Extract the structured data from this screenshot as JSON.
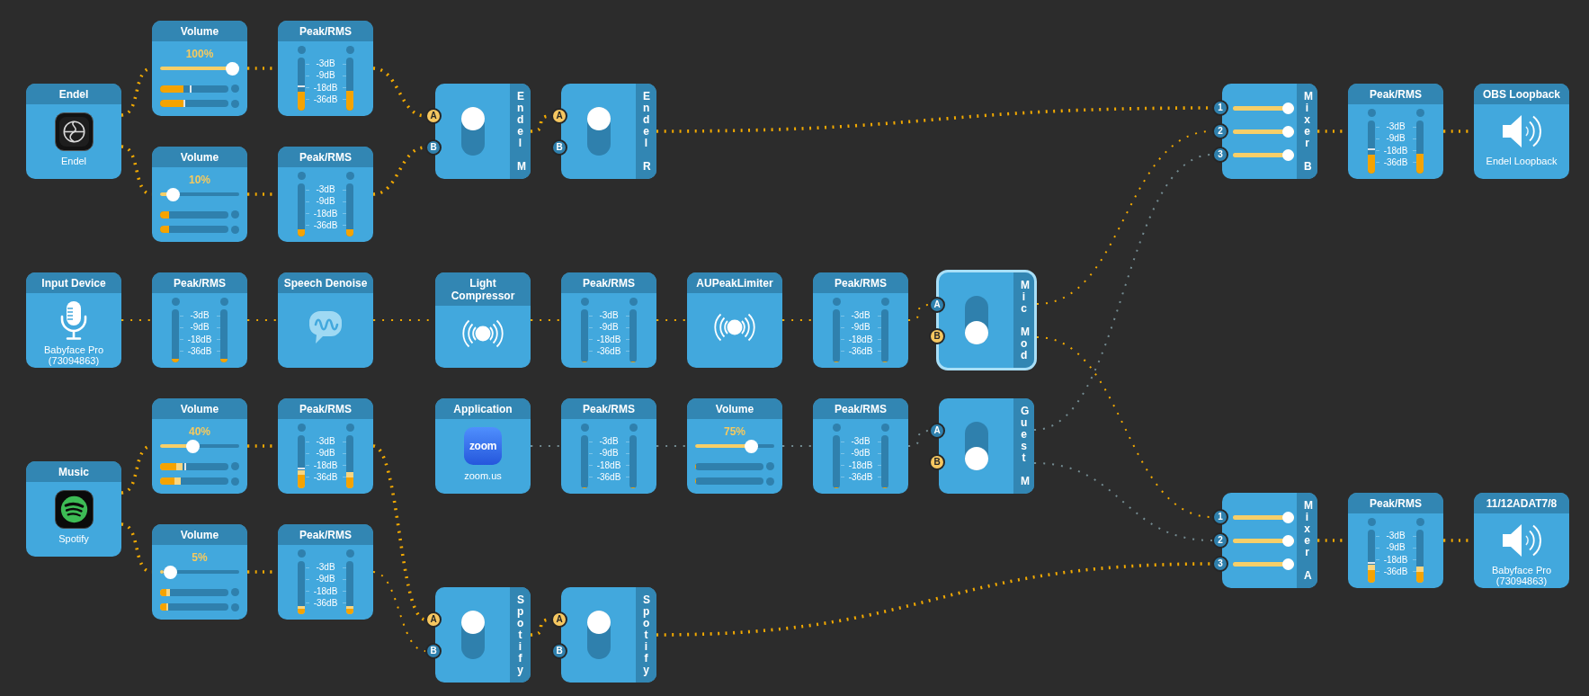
{
  "nodes": [
    {
      "kind": "volume",
      "title": "Volume",
      "reading": "100%",
      "level": 1,
      "channels": [
        {
          "level": 0.35,
          "hold": {
            "level": 0.45
          }
        },
        {
          "level": 0.35,
          "hold": {
            "level": 0.36
          }
        }
      ],
      "selected": false
    },
    {
      "kind": "meter",
      "title": "Peak/RMS",
      "scale": [
        "-3dB",
        "-9dB",
        "-18dB",
        "-36dB"
      ],
      "channels": [
        {
          "level": 0.36,
          "hold": {
            "level": 0.46
          }
        },
        {
          "level": 0.37
        }
      ],
      "selected": false
    },
    {
      "kind": "source",
      "title": "Endel",
      "caption": "Endel",
      "selected": false
    },
    {
      "kind": "switch",
      "label": "Endel M",
      "ports": [
        {
          "label": "A",
          "selected": true
        },
        {
          "label": "B",
          "selected": false
        }
      ],
      "selected": false
    },
    {
      "kind": "switch",
      "label": "Endel R",
      "ports": [
        {
          "label": "A",
          "selected": true
        },
        {
          "label": "B",
          "selected": false
        }
      ],
      "selected": false
    },
    {
      "kind": "mixer",
      "label": "Mixer B",
      "inputs": [
        {
          "label": "1",
          "level": 1
        },
        {
          "label": "2",
          "level": 1
        },
        {
          "label": "3",
          "level": 1
        }
      ],
      "selected": false
    },
    {
      "kind": "meter",
      "title": "Peak/RMS",
      "scale": [
        "-3dB",
        "-9dB",
        "-18dB",
        "-36dB"
      ],
      "channels": [
        {
          "level": 0.35,
          "hold": {
            "level": 0.45
          }
        },
        {
          "level": 0.38
        }
      ],
      "selected": false
    },
    {
      "kind": "output",
      "title": "OBS Loopback",
      "caption": "Endel Loopback",
      "selected": false
    },
    {
      "kind": "volume",
      "title": "Volume",
      "reading": "10%",
      "level": 0.1,
      "channels": [
        {
          "level": 0.13
        },
        {
          "level": 0.13
        }
      ],
      "selected": false
    },
    {
      "kind": "meter",
      "title": "Peak/RMS",
      "scale": [
        "-3dB",
        "-9dB",
        "-18dB",
        "-36dB"
      ],
      "channels": [
        {
          "level": 0.13
        },
        {
          "level": 0.13
        }
      ],
      "selected": false
    },
    {
      "kind": "source",
      "title": "Input Device",
      "caption": "Babyface Pro (73094863)",
      "selected": false
    },
    {
      "kind": "meter",
      "title": "Peak/RMS",
      "scale": [
        "-3dB",
        "-9dB",
        "-18dB",
        "-36dB"
      ],
      "channels": [
        {
          "level": 0.07
        },
        {
          "level": 0.07
        }
      ],
      "selected": false
    },
    {
      "kind": "effect",
      "title": "Speech Denoise",
      "selected": false
    },
    {
      "kind": "effect",
      "title": "Light Compressor",
      "selected": false
    },
    {
      "kind": "meter",
      "title": "Peak/RMS",
      "scale": [
        "-3dB",
        "-9dB",
        "-18dB",
        "-36dB"
      ],
      "channels": [
        {
          "level": 0
        },
        {
          "level": 0
        }
      ],
      "selected": false
    },
    {
      "kind": "effect",
      "title": "AUPeakLimiter",
      "selected": false
    },
    {
      "kind": "meter",
      "title": "Peak/RMS",
      "scale": [
        "-3dB",
        "-9dB",
        "-18dB",
        "-36dB"
      ],
      "channels": [
        {
          "level": 0
        },
        {
          "level": 0
        }
      ],
      "selected": false
    },
    {
      "kind": "switch",
      "label": "Mic Mod",
      "ports": [
        {
          "label": "A",
          "selected": false
        },
        {
          "label": "B",
          "selected": true
        }
      ],
      "selected": true
    },
    {
      "kind": "volume",
      "title": "Volume",
      "reading": "40%",
      "level": 0.4,
      "channels": [
        {
          "level": 0.24,
          "peak": {
            "level": 0.33
          },
          "hold": {
            "level": 0.37
          }
        },
        {
          "level": 0.21,
          "peak": {
            "level": 0.31
          }
        }
      ],
      "selected": false
    },
    {
      "kind": "meter",
      "title": "Peak/RMS",
      "scale": [
        "-3dB",
        "-9dB",
        "-18dB",
        "-36dB"
      ],
      "channels": [
        {
          "level": 0.25,
          "peak": {
            "level": 0.34
          },
          "hold": {
            "level": 0.37
          }
        },
        {
          "level": 0.21,
          "peak": {
            "level": 0.31
          }
        }
      ],
      "selected": false
    },
    {
      "kind": "source",
      "title": "Application",
      "logo_text": "zoom",
      "caption": "zoom.us",
      "selected": false
    },
    {
      "kind": "meter",
      "title": "Peak/RMS",
      "scale": [
        "-3dB",
        "-9dB",
        "-18dB",
        "-36dB"
      ],
      "channels": [
        {
          "level": 0
        },
        {
          "level": 0
        }
      ],
      "selected": false
    },
    {
      "kind": "volume",
      "title": "Volume",
      "reading": "75%",
      "level": 0.75,
      "channels": [
        {
          "level": 0
        },
        {
          "level": 0
        }
      ],
      "selected": false
    },
    {
      "kind": "meter",
      "title": "Peak/RMS",
      "scale": [
        "-3dB",
        "-9dB",
        "-18dB",
        "-36dB"
      ],
      "channels": [
        {
          "level": 0
        },
        {
          "level": 0
        }
      ],
      "selected": false
    },
    {
      "kind": "switch",
      "label": "Guest M",
      "ports": [
        {
          "label": "A",
          "selected": false
        },
        {
          "label": "B",
          "selected": true
        }
      ],
      "selected": false
    },
    {
      "kind": "source",
      "title": "Music",
      "caption": "Spotify",
      "selected": false
    },
    {
      "kind": "volume",
      "title": "Volume",
      "reading": "5%",
      "level": 0.05,
      "channels": [
        {
          "level": 0.09,
          "peak": {
            "level": 0.14
          }
        },
        {
          "level": 0.09,
          "peak": {
            "level": 0.12
          }
        }
      ],
      "selected": false
    },
    {
      "kind": "meter",
      "title": "Peak/RMS",
      "scale": [
        "-3dB",
        "-9dB",
        "-18dB",
        "-36dB"
      ],
      "channels": [
        {
          "level": 0.11,
          "peak": {
            "level": 0.15
          }
        },
        {
          "level": 0.11,
          "peak": {
            "level": 0.15
          }
        }
      ],
      "selected": false
    },
    {
      "kind": "mixer",
      "label": "Mixer A",
      "inputs": [
        {
          "label": "1",
          "level": 1
        },
        {
          "label": "2",
          "level": 1
        },
        {
          "label": "3",
          "level": 1
        }
      ],
      "selected": false
    },
    {
      "kind": "meter",
      "title": "Peak/RMS",
      "scale": [
        "-3dB",
        "-9dB",
        "-18dB",
        "-36dB"
      ],
      "channels": [
        {
          "level": 0.24,
          "peak": {
            "level": 0.34
          },
          "hold": {
            "level": 0.37
          }
        },
        {
          "level": 0.21,
          "peak": {
            "level": 0.31
          }
        }
      ],
      "selected": false
    },
    {
      "kind": "output",
      "title": "11/12ADAT7/8",
      "caption": "Babyface Pro (73094863)",
      "selected": false
    },
    {
      "kind": "switch",
      "label": "Spotify",
      "ports": [
        {
          "label": "A",
          "selected": true
        },
        {
          "label": "B",
          "selected": false
        }
      ],
      "selected": false
    },
    {
      "kind": "switch",
      "label": "Spotify",
      "ports": [
        {
          "label": "A",
          "selected": true
        },
        {
          "label": "B",
          "selected": false
        }
      ],
      "selected": false
    }
  ],
  "wires": [
    {
      "kind": "strong"
    },
    {
      "kind": "strong"
    },
    {
      "kind": "strong"
    },
    {
      "kind": "strong"
    },
    {
      "kind": "strong"
    },
    {
      "kind": "strong"
    },
    {
      "kind": "strong"
    },
    {
      "kind": "strong"
    },
    {
      "kind": "strong"
    },
    {
      "kind": "strong"
    },
    {
      "kind": "weak"
    },
    {
      "kind": "weak"
    },
    {
      "kind": "weak"
    },
    {
      "kind": "weak"
    },
    {
      "kind": "weak"
    },
    {
      "kind": "weak"
    },
    {
      "kind": "weak"
    },
    {
      "kind": "weak"
    },
    {
      "kind": "weak"
    },
    {
      "kind": "none"
    },
    {
      "kind": "none"
    },
    {
      "kind": "none"
    },
    {
      "kind": "none"
    },
    {
      "kind": "none"
    },
    {
      "kind": "none"
    },
    {
      "kind": "strong"
    },
    {
      "kind": "strong"
    },
    {
      "kind": "strong"
    },
    {
      "kind": "strong"
    },
    {
      "kind": "strong"
    },
    {
      "kind": "weak"
    },
    {
      "kind": "strong"
    },
    {
      "kind": "strong"
    },
    {
      "kind": "strong"
    },
    {
      "kind": "strong"
    }
  ]
}
